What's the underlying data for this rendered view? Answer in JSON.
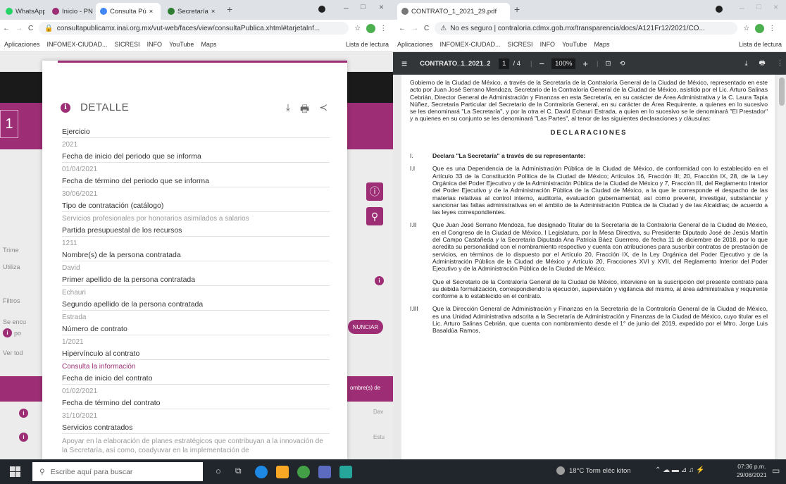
{
  "left": {
    "tabs": [
      {
        "label": "WhatsApp",
        "color": "#25d366"
      },
      {
        "label": "Inicio - PNT",
        "color": "#9d2e75"
      },
      {
        "label": "Consulta Pú",
        "color": "#4285f4"
      },
      {
        "label": "Secretaría",
        "color": "#2e7d32"
      }
    ],
    "url": "consultapublicamx.inai.org.mx/vut-web/faces/view/consultaPublica.xhtml#tarjetaInf...",
    "bookmarks": [
      "Aplicaciones",
      "INFOMEX-CIUDAD...",
      "SICRESI",
      "INFO",
      "YouTube",
      "Maps"
    ],
    "reading_list": "Lista de lectura",
    "bg_labels": [
      "Trime",
      "Utiliza",
      "Filtros",
      "Se encu",
      "po",
      "Ver tod"
    ],
    "bg_button": "NUNCIAR",
    "bg_col": "ombre(s) de",
    "bg_cells": [
      "Dav",
      "Estu",
      "Fach"
    ],
    "modal": {
      "title": "DETALLE",
      "fields": [
        {
          "label": "Ejercicio",
          "value": "2021"
        },
        {
          "label": "Fecha de inicio del periodo que se informa",
          "value": "01/04/2021"
        },
        {
          "label": "Fecha de término del periodo que se informa",
          "value": "30/06/2021"
        },
        {
          "label": "Tipo de contratación (catálogo)",
          "value": "Servicios profesionales por honorarios asimilados a salarios"
        },
        {
          "label": "Partida presupuestal de los recursos",
          "value": "1211"
        },
        {
          "label": "Nombre(s) de la persona contratada",
          "value": "David"
        },
        {
          "label": "Primer apellido de la persona contratada",
          "value": "Echauri"
        },
        {
          "label": "Segundo apellido de la persona contratada",
          "value": "Estrada"
        },
        {
          "label": "Número de contrato",
          "value": "1/2021"
        },
        {
          "label": "Hipervínculo al contrato",
          "value": "Consulta la información"
        },
        {
          "label": "Fecha de inicio del contrato",
          "value": "01/02/2021"
        },
        {
          "label": "Fecha de término del contrato",
          "value": "31/10/2021"
        },
        {
          "label": "Servicios contratados",
          "value": "Apoyar en la elaboración de planes estratégicos que contribuyan a la innovación de la Secretaría, así como, coadyuvar en la implementación de"
        }
      ]
    }
  },
  "right": {
    "tab": "CONTRATO_1_2021_29.pdf",
    "url": "No es seguro | contraloria.cdmx.gob.mx/transparencia/docs/A121Fr12/2021/CO...",
    "bookmarks": [
      "Aplicaciones",
      "INFOMEX-CIUDAD...",
      "SICRESI",
      "INFO",
      "YouTube",
      "Maps"
    ],
    "reading_list": "Lista de lectura",
    "pdf": {
      "filename": "CONTRATO_1_2021_2...",
      "page": "1",
      "pages": "/ 4",
      "zoom": "100%",
      "intro": "Gobierno de la Ciudad de México, a través de la Secretaría de la Contraloría General de la Ciudad de México, representado en este acto por Juan José Serrano Mendoza, Secretario de la Contraloría General de la Ciudad de México, asistido por el Lic. Arturo Salinas Cebrián, Director General de Administración y Finanzas en esta Secretaría, en su carácter de Área Administrativa y la C. Laura Tapia Núñez, Secretaria Particular del Secretario de la Contraloría General, en su carácter de Área Requirente, a quienes en lo sucesivo se les denominará \"La Secretaría\", y por la otra el C. David Echauri Estrada, a quien en lo sucesivo se le denominará \"El Prestador\" y a quienes en su conjunto se les denominará \"Las Partes\", al tenor de las siguientes declaraciones y cláusulas:",
      "heading": "DECLARACIONES",
      "paras": [
        {
          "n": "I.",
          "t": "Declara \"La Secretaría\" a través de su representante:"
        },
        {
          "n": "I.I",
          "t": "Que es una Dependencia de la Administración Pública de la Ciudad de México, de conformidad con lo establecido en el Artículo 33 de la Constitución Política de la Ciudad de México; Artículos 16, Fracción III; 20, Fracción IX, 28, de la Ley Orgánica del Poder Ejecutivo y de la Administración Pública de la Ciudad de México y 7, Fracción III, del Reglamento Interior del Poder Ejecutivo y de la Administración Pública de la Ciudad de México, a la que le corresponde el despacho de las materias relativas al control interno, auditoría, evaluación gubernamental; así como prevenir, investigar, substanciar y sancionar las faltas administrativas en el ámbito de la Administración Pública de la Ciudad y de las Alcaldías; de acuerdo a las leyes correspondientes."
        },
        {
          "n": "I.II",
          "t": "Que Juan José Serrano Mendoza, fue designado Titular de la Secretaría de la Contraloría General de la Ciudad de México, en el Congreso de la Ciudad de México, I Legislatura, por la Mesa Directiva, su Presidente Diputado José de Jesús Martín del Campo Castañeda y la Secretaria Diputada Ana Patricia Báez Guerrero, de fecha 11 de diciembre de 2018, por lo que acredita su personalidad con el nombramiento respectivo y cuenta con atribuciones para suscribir contratos de prestación de servicios, en términos de lo dispuesto por el Artículo 20, Fracción IX, de la Ley Orgánica del Poder Ejecutivo y de la Administración Pública de la Ciudad de México y Artículo 20, Fracciones XVI y XVII, del Reglamento Interior del Poder Ejecutivo y de la Administración Pública de la Ciudad de México."
        },
        {
          "n": "",
          "t": "Que el Secretario de la Contraloría General de la Ciudad de México, interviene en la suscripción del presente contrato para su debida formalización, correspondiendo la ejecución, supervisión y vigilancia del mismo, al área administrativa y requirente conforme a lo establecido en el contrato."
        },
        {
          "n": "I.III",
          "t": "Que la Dirección General de Administración y Finanzas en la Secretaría de la Contraloría General de la Ciudad de México, es una Unidad Administrativa adscrita a la Secretaría de Administración y Finanzas de la Ciudad de México, cuyo titular es el Lic. Arturo Salinas Cebrián, que cuenta con nombramiento desde el 1° de junio del 2019, expedido por el Mtro. Jorge Luis Basaldúa Ramos,"
        }
      ]
    }
  },
  "taskbar": {
    "search_placeholder": "Escribe aquí para buscar",
    "weather": "18°C Torm eléc kiton",
    "time": "07:36 p.m.",
    "date": "29/08/2021"
  },
  "colors": {
    "brand": "#9d2e75",
    "pdf_toolbar": "#323639",
    "taskbar": "#20262b"
  }
}
